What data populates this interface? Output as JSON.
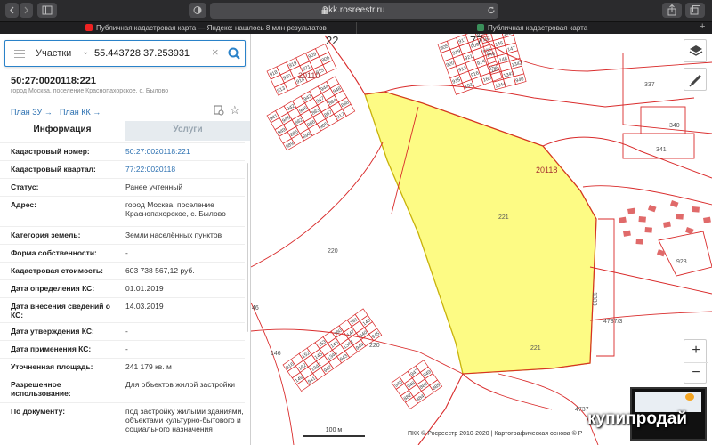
{
  "browser": {
    "url": "pkk.rosreestr.ru",
    "tabs": [
      {
        "title": "Публичная кадастровая карта — Яндекс: нашлось 8 млн результатов"
      },
      {
        "title": "Публичная кадастровая карта"
      }
    ]
  },
  "search": {
    "type_label": "Участки",
    "value": "55.443728 37.253931"
  },
  "object": {
    "number": "50:27:0020118:221",
    "address_short": "город Москва, поселение Краснопахорское, с. Былово"
  },
  "actions": {
    "plan_zu": "План ЗУ",
    "plan_kk": "План КК"
  },
  "tabs": {
    "info": "Информация",
    "services": "Услуги"
  },
  "fields": [
    {
      "label": "Кадастровый номер:",
      "value": "50:27:0020118:221",
      "link": true
    },
    {
      "label": "Кадастровый квартал:",
      "value": "77:22:0020118",
      "link": true
    },
    {
      "label": "Статус:",
      "value": "Ранее учтенный"
    },
    {
      "label": "Адрес:",
      "value": "город Москва, поселение Краснопахорское, с. Былово"
    },
    {
      "label": "Категория земель:",
      "value": "Земли населённых пунктов"
    },
    {
      "label": "Форма собственности:",
      "value": "-"
    },
    {
      "label": "Кадастровая стоимость:",
      "value": "603 738 567,12 руб."
    },
    {
      "label": "Дата определения КС:",
      "value": "01.01.2019"
    },
    {
      "label": "Дата внесения сведений о КС:",
      "value": "14.03.2019"
    },
    {
      "label": "Дата утверждения КС:",
      "value": "-"
    },
    {
      "label": "Дата применения КС:",
      "value": "-"
    },
    {
      "label": "Уточненная площадь:",
      "value": "241 179 кв. м"
    },
    {
      "label": "Разрешенное использование:",
      "value": "Для объектов жилой застройки"
    },
    {
      "label": "По документу:",
      "value": "под застройку жилыми зданиями, объектами культурно-бытового и социального назначения"
    }
  ],
  "map": {
    "labels": {
      "block_20110": "20110",
      "block_20118": "20118",
      "region_22": "22",
      "region_77": "77",
      "parcel_main": "221",
      "parcel_main2": "221",
      "parcel_221b": "221",
      "parcel_220a": "220",
      "parcel_220b": "220",
      "parcel_337": "337",
      "parcel_340": "340",
      "parcel_341": "341",
      "parcel_923": "923",
      "parcel_1330": "1330",
      "parcel_4737": "4737/3",
      "parcel_146": "146",
      "parcel_46": "46",
      "parcel_4737b": "4737",
      "lots": [
        "905",
        "917",
        "918",
        "919",
        "909",
        "920",
        "921",
        "906",
        "913",
        "914",
        "915",
        "916",
        "152",
        "153",
        "160",
        "161",
        "162",
        "145",
        "146",
        "147",
        "148",
        "149",
        "1342",
        "1343",
        "1344",
        "940",
        "941",
        "942",
        "943",
        "944",
        "945",
        "946",
        "947",
        "948",
        "949",
        "882",
        "883",
        "884",
        "885",
        "886",
        "887",
        "888",
        "889",
        "890"
      ]
    },
    "scale": "100 м",
    "copyright": "ПКК © Росреестр 2010-2020 | Картографическая основа © Р",
    "highlight_color": "#fdfb73",
    "line_color": "#d92b2b"
  },
  "watermark": "купипродай"
}
